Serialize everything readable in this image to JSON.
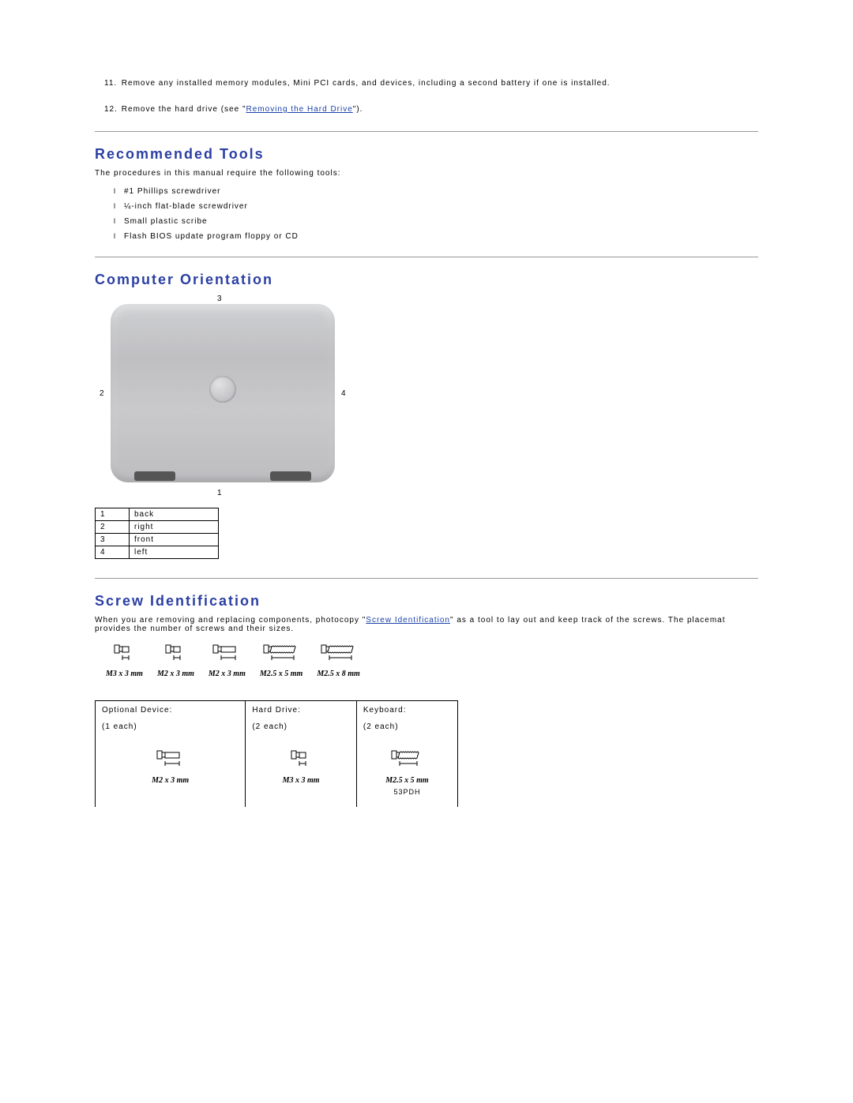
{
  "steps": [
    {
      "num": "11.",
      "text": "Remove any installed memory modules, Mini PCI cards, and devices, including a second battery if one is installed."
    },
    {
      "num": "12.",
      "pre": "Remove the hard drive (see \"",
      "link": "Removing the Hard Drive",
      "post": "\")."
    }
  ],
  "sections": {
    "tools": {
      "title": "Recommended Tools",
      "intro": "The procedures in this manual require the following tools:",
      "items": [
        "#1 Phillips screwdriver",
        "¼-inch flat-blade screwdriver",
        "Small plastic scribe",
        "Flash BIOS update program floppy or CD"
      ]
    },
    "orientation": {
      "title": "Computer Orientation",
      "labels": {
        "top": "3",
        "left": "2",
        "right": "4",
        "bottom": "1"
      },
      "table": [
        {
          "n": "1",
          "v": "back"
        },
        {
          "n": "2",
          "v": "right"
        },
        {
          "n": "3",
          "v": "front"
        },
        {
          "n": "4",
          "v": "left"
        }
      ]
    },
    "screws": {
      "title": "Screw Identification",
      "intro_pre": "When you are removing and replacing components, photocopy \"",
      "intro_link": "Screw Identification",
      "intro_post": "\" as a tool to lay out and keep track of the screws. The placemat provides the number of screws and their sizes.",
      "row": [
        {
          "label": "M3 x 3 mm",
          "shaft": 8,
          "thread": false
        },
        {
          "label": "M2 x 3 mm",
          "shaft": 8,
          "thread": false
        },
        {
          "label": "M2 x 3 mm",
          "shaft": 18,
          "thread": false
        },
        {
          "label": "M2.5 x 5 mm",
          "shaft": 28,
          "thread": true
        },
        {
          "label": "M2.5 x 8 mm",
          "shaft": 28,
          "thread": true
        }
      ],
      "table": [
        {
          "hdr": "Optional Device:",
          "qty": "(1 each)",
          "label": "M2 x 3 mm",
          "shaft": 18,
          "thread": false,
          "code": ""
        },
        {
          "hdr": "Hard Drive:",
          "qty": "(2 each)",
          "label": "M3 x 3 mm",
          "shaft": 8,
          "thread": false,
          "code": ""
        },
        {
          "hdr": "Keyboard:",
          "qty": "(2 each)",
          "label": "M2.5 x 5 mm",
          "shaft": 22,
          "thread": true,
          "code": "53PDH"
        }
      ]
    }
  }
}
